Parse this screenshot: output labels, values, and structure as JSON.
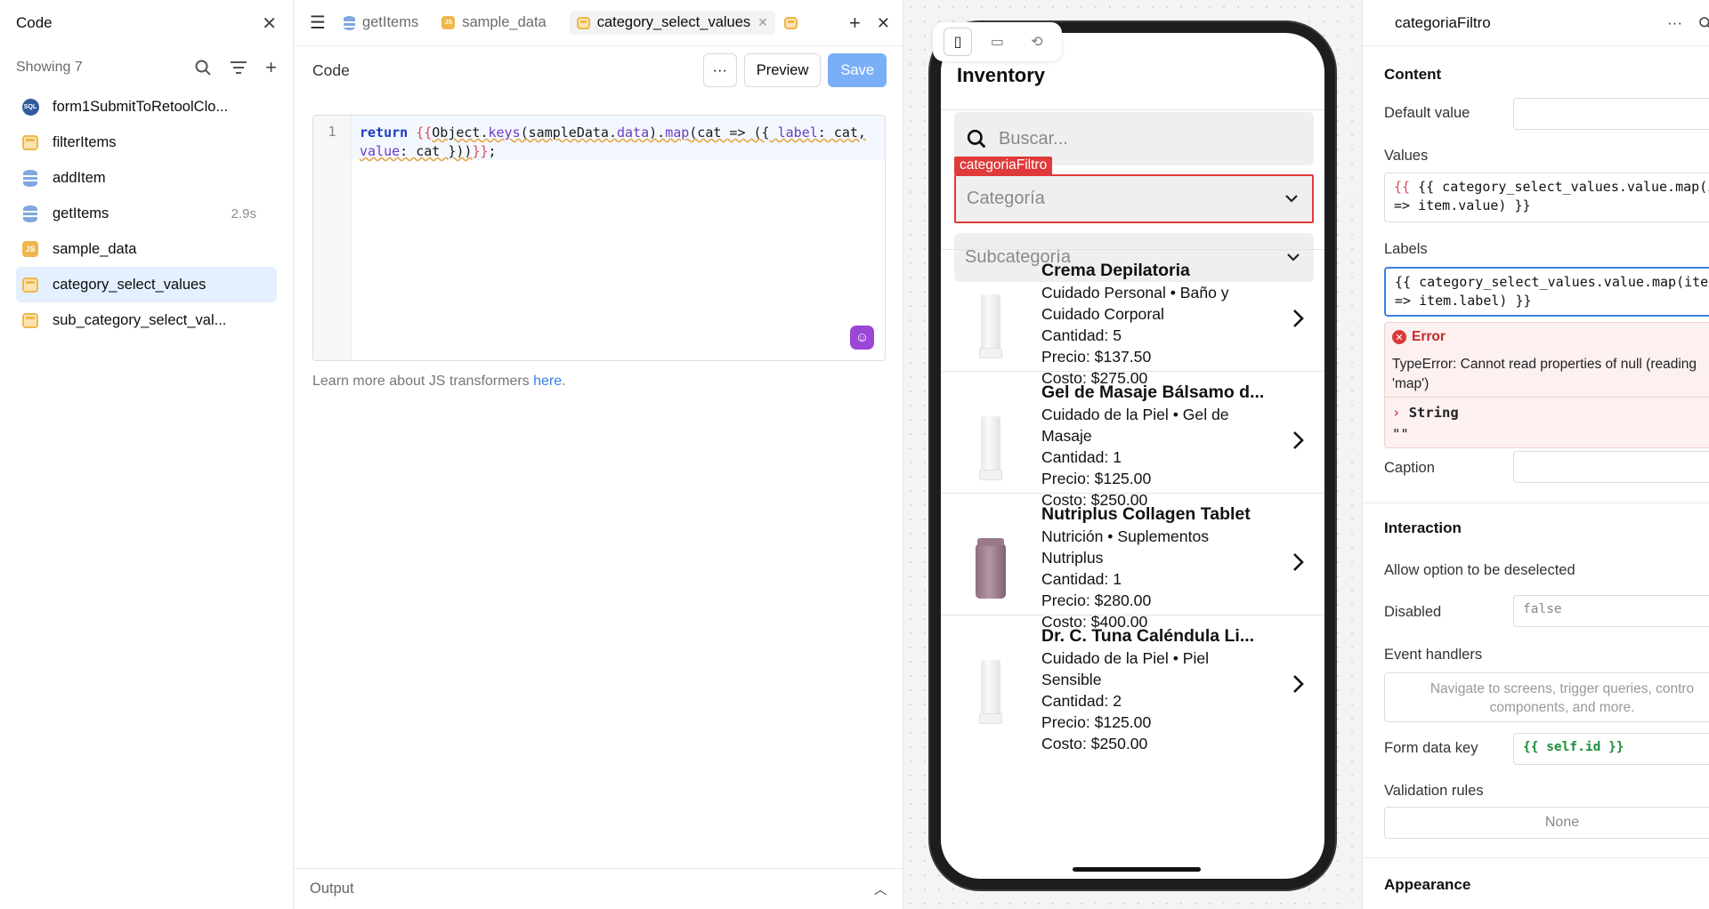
{
  "left_panel": {
    "title": "Code",
    "showing": "Showing 7",
    "items": [
      {
        "label": "form1SubmitToRetoolClo...",
        "icon": "sql-icon",
        "time": ""
      },
      {
        "label": "filterItems",
        "icon": "transformer-icon",
        "time": ""
      },
      {
        "label": "addItem",
        "icon": "database-icon",
        "time": ""
      },
      {
        "label": "getItems",
        "icon": "database-icon",
        "time": "2.9s"
      },
      {
        "label": "sample_data",
        "icon": "js-icon",
        "time": ""
      },
      {
        "label": "category_select_values",
        "icon": "transformer-icon",
        "time": "",
        "active": true
      },
      {
        "label": "sub_category_select_val...",
        "icon": "transformer-icon",
        "time": ""
      }
    ]
  },
  "editor": {
    "tabs": [
      "getItems",
      "sample_data",
      "category_select_values"
    ],
    "code_title": "Code",
    "more_label": "···",
    "preview_label": "Preview",
    "save_label": "Save",
    "line_number": "1",
    "code": {
      "kw": "return",
      "open": "{{",
      "p1": "Object.",
      "keys": "keys",
      "p2": "(sampleData.",
      "data": "data",
      "p3": ").",
      "map": "map",
      "p4": "(cat => ({ ",
      "label": "label",
      "p5": ": cat,",
      "value": "value",
      "p6": ": cat }))",
      "close": "}}",
      "semi": ";"
    },
    "learn_text": "Learn more about JS transformers ",
    "learn_link": "here",
    "learn_end": ".",
    "output_label": "Output"
  },
  "phone": {
    "title": "Inventory",
    "search_placeholder": "Buscar...",
    "category_tag": "categoriaFiltro",
    "category_placeholder": "Categoría",
    "subcategory_placeholder": "Subcategoría",
    "products": [
      {
        "name": "Crema Depilatoria",
        "line1": "Cuidado Personal • Baño y",
        "line2": "Cuidado Corporal",
        "qty": "Cantidad: 5",
        "price": "Precio: $137.50",
        "cost": "Costo: $275.00",
        "image": "tube"
      },
      {
        "name": "Gel de Masaje Bálsamo d...",
        "line1": "Cuidado de la Piel • Gel de",
        "line2": "Masaje",
        "qty": "Cantidad: 1",
        "price": "Precio: $125.00",
        "cost": "Costo: $250.00",
        "image": "tube"
      },
      {
        "name": "Nutriplus Collagen Tablet",
        "line1": "Nutrición • Suplementos",
        "line2": "Nutriplus",
        "qty": "Cantidad: 1",
        "price": "Precio: $280.00",
        "cost": "Costo: $400.00",
        "image": "jar"
      },
      {
        "name": "Dr. C. Tuna Caléndula Li...",
        "line1": "Cuidado de la Piel • Piel",
        "line2": "Sensible",
        "qty": "Cantidad: 2",
        "price": "Precio: $125.00",
        "cost": "Costo: $250.00",
        "image": "tube"
      }
    ]
  },
  "inspector": {
    "title": "categoriaFiltro",
    "content_heading": "Content",
    "default_value_label": "Default value",
    "values_label": "Values",
    "values_code_1": "{{ category_select_values.value.map(ite",
    "values_code_2": "=> item.value) }}",
    "labels_label": "Labels",
    "labels_code_1": "{{ category_select_values.value.map(ite",
    "labels_code_2": "=> item.label) }}",
    "error_title": "Error",
    "error_msg_1": "TypeError: Cannot read properties of null (reading",
    "error_msg_2": "'map')",
    "error_type": "String",
    "error_value": "\"\"",
    "caption_label": "Caption",
    "interaction_heading": "Interaction",
    "deselect_label": "Allow option to be deselected",
    "disabled_label": "Disabled",
    "disabled_value": "false",
    "event_handlers_label": "Event handlers",
    "event_handlers_placeholder_1": "Navigate to screens, trigger queries, contro",
    "event_handlers_placeholder_2": "components, and more.",
    "form_key_label": "Form data key",
    "form_key_value": "{{ self.id }}",
    "validation_label": "Validation rules",
    "validation_value": "None",
    "appearance_heading": "Appearance"
  },
  "colors": {
    "accent": "#3b82e0",
    "error": "#e03a3a",
    "save": "#7aaef7"
  }
}
